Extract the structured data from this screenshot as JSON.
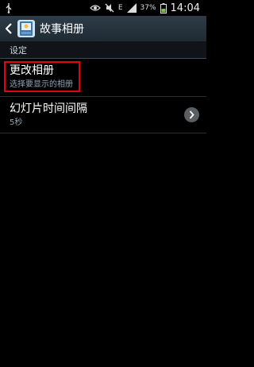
{
  "status_bar": {
    "battery_percent": "37%",
    "network": "E",
    "time": "14:04",
    "icons": [
      "usb-icon",
      "eye-icon",
      "mute-icon",
      "data-e-icon",
      "signal-icon",
      "battery-icon"
    ]
  },
  "action_bar": {
    "title": "故事相册"
  },
  "section": {
    "title": "设定"
  },
  "settings": [
    {
      "title": "更改相册",
      "subtitle": "选择要显示的相册"
    },
    {
      "title": "幻灯片时间间隔",
      "subtitle": "5秒"
    }
  ],
  "colors": {
    "action_bar": "#2e3c48",
    "highlight": "#e60012",
    "subtitle": "#8fa3b3"
  }
}
